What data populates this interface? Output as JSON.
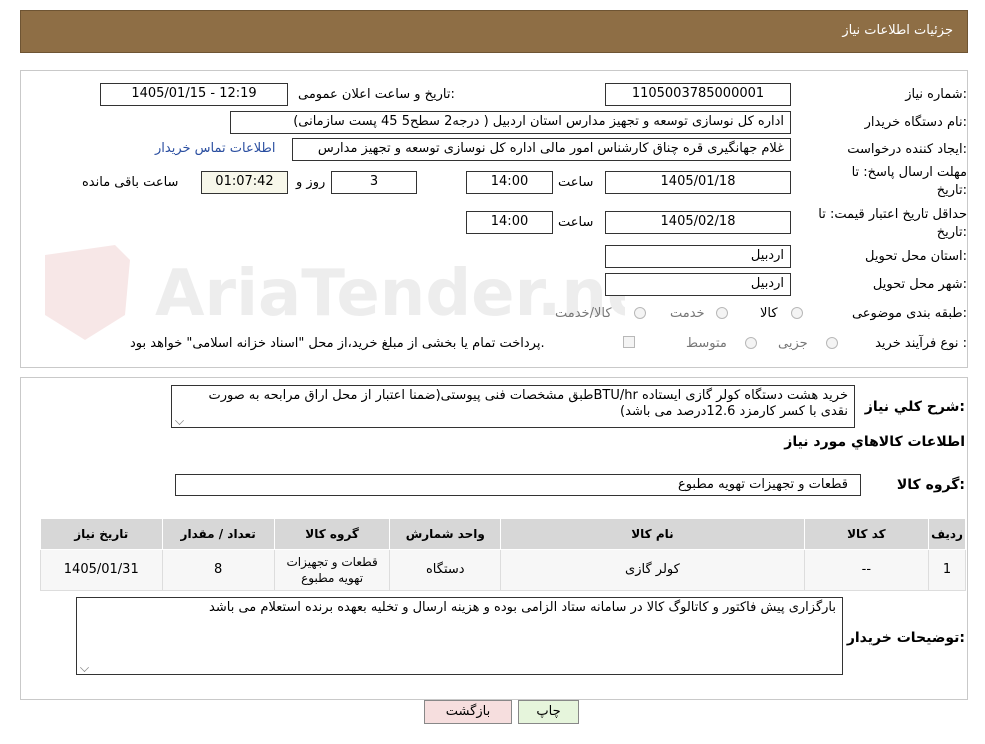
{
  "header": {
    "title": "جزئیات اطلاعات نیاز"
  },
  "form": {
    "need_number_label": "شماره نیاز:",
    "need_number": "1105003785000001",
    "announce_label": "تاریخ و ساعت اعلان عمومی:",
    "announce_value": "1405/01/15 - 12:19",
    "buyer_label": "نام دستگاه خریدار:",
    "buyer_value": "اداره کل نوسازی   توسعه و تجهیز مدارس استان اردبیل ( درجه2  سطح5  45 پست سازمانی)",
    "creator_label": "ایجاد کننده درخواست:",
    "creator_value": "غلام جهانگیری قره چناق کارشناس امور مالی اداره کل نوسازی   توسعه و تجهیز مدارس",
    "contact_link": "اطلاعات تماس خریدار",
    "deadline_label_1": "مهلت ارسال پاسخ: تا",
    "deadline_label_2": "تاریخ:",
    "deadline_date": "1405/01/18",
    "time_label": "ساعت",
    "deadline_time": "14:00",
    "days_value": "3",
    "days_label": "روز و",
    "remaining_time": "01:07:42",
    "remaining_label": "ساعت باقی مانده",
    "validity_label_1": "حداقل تاریخ اعتبار قیمت: تا",
    "validity_label_2": "تاریخ:",
    "validity_date": "1405/02/18",
    "validity_time": "14:00",
    "province_label": "استان محل تحویل:",
    "province_value": "اردبیل",
    "city_label": "شهر محل تحویل:",
    "city_value": "اردبیل",
    "category_label": "طبقه بندی موضوعی:",
    "category_options": [
      "کالا",
      "خدمت",
      "کالا/خدمت"
    ],
    "process_label": "نوع فرآیند خرید :",
    "process_options": [
      "جزیی",
      "متوسط"
    ],
    "payment_note": "پرداخت تمام یا بخشی از مبلغ خرید،از محل \"اسناد خزانه اسلامی\" خواهد بود."
  },
  "summary": {
    "label": "شرح کلي نياز:",
    "text": "خرید هشت دستگاه کولر گازی ایستاده BTU/hrطبق مشخصات فنی پیوستی(ضمنا اعتبار از محل اراق مرابحه به صورت نقدی با کسر کارمزد 12.6درصد می باشد)",
    "goods_info_title": "اطلاعات کالاهاي مورد نياز",
    "goods_group_label": "گروه کالا:",
    "goods_group_value": "قطعات و تجهیزات تهویه مطبوع"
  },
  "table": {
    "headers": [
      "ردیف",
      "کد کالا",
      "نام کالا",
      "واحد شمارش",
      "گروه کالا",
      "تعداد / مقدار",
      "تاریخ نیاز"
    ],
    "rows": [
      [
        "1",
        "--",
        "کولر گازی",
        "دستگاه",
        "قطعات و تجهیزات تهویه مطبوع",
        "8",
        "1405/01/31"
      ]
    ]
  },
  "buyer_notes": {
    "label": "توضیحات خریدار:",
    "text": "بارگزاری پیش فاکتور و کاتالوگ کالا در سامانه ستاد الزامی بوده و هزینه ارسال و تخلیه بعهده برنده استعلام می باشد"
  },
  "buttons": {
    "print": "چاپ",
    "back": "بازگشت"
  },
  "watermark": {
    "text": "AriaTender.neT"
  },
  "colors": {
    "header_bg": "#8e6e45",
    "link": "#2a4ea0",
    "back_btn_bg": "#f6dede",
    "print_btn_bg": "#e6f5dc"
  }
}
